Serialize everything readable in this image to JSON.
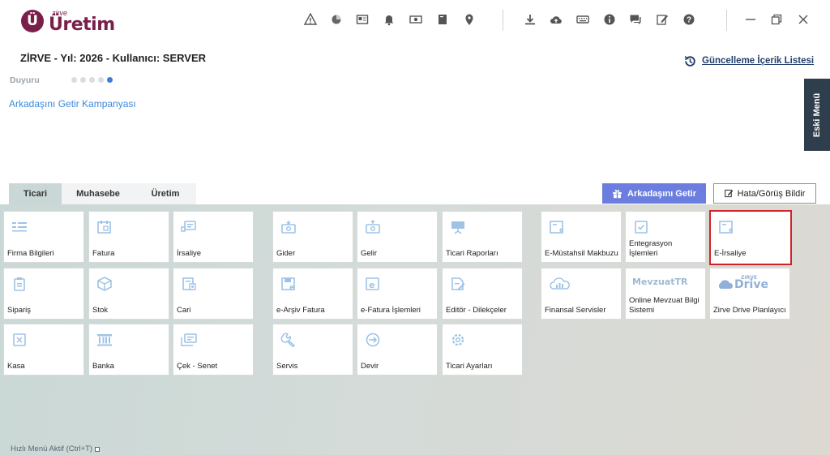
{
  "app": {
    "logo_small": "zirve",
    "logo_big": "Üretim",
    "logo_mark": "Ü",
    "brand_color": "#7a1f4a"
  },
  "toolbar": {
    "icons": [
      "warning-icon",
      "chart-icon",
      "news-icon",
      "bell-icon",
      "money-icon",
      "book-icon",
      "location-icon",
      "download-icon",
      "cloud-upload-icon",
      "keyboard-icon",
      "info-icon",
      "chat-icon",
      "edit-icon",
      "help-icon"
    ],
    "window": [
      "minimize-icon",
      "restore-icon",
      "close-icon"
    ]
  },
  "header": {
    "title": "ZİRVE - Yıl: 2026 - Kullanıcı: SERVER",
    "update_link": "Güncelleme İçerik Listesi",
    "announcement_label": "Duyuru",
    "campaign_link": "Arkadaşını Getir Kampanyası",
    "old_menu": "Eski Menü"
  },
  "tabs": [
    {
      "label": "Ticari",
      "active": true
    },
    {
      "label": "Muhasebe",
      "active": false
    },
    {
      "label": "Üretim",
      "active": false
    }
  ],
  "buttons": {
    "invite_friend": "Arkadaşını Getir",
    "report_bug": "Hata/Görüş Bildir",
    "accent": "#6b7ee0"
  },
  "tiles": [
    {
      "id": "firma",
      "label": "Firma Bilgileri",
      "icon": "list-icon"
    },
    {
      "id": "fatura",
      "label": "Fatura",
      "icon": "invoice-icon"
    },
    {
      "id": "irsaliye",
      "label": "İrsaliye",
      "icon": "truck-icon"
    },
    {
      "id": "gider",
      "label": "Gider",
      "icon": "expense-icon"
    },
    {
      "id": "gelir",
      "label": "Gelir",
      "icon": "income-icon"
    },
    {
      "id": "ticari-raporlar",
      "label": "Ticari Raporları",
      "icon": "presentation-icon"
    },
    {
      "id": "e-mustahsil",
      "label": "E-Müstahsil Makbuzu",
      "icon": "e-document-icon"
    },
    {
      "id": "entegrasyon",
      "label": "Entegrasyon İşlemleri",
      "icon": "check-document-icon"
    },
    {
      "id": "e-irsaliye",
      "label": "E-İrsaliye",
      "icon": "e-document-icon",
      "highlighted": true
    },
    {
      "id": "siparis",
      "label": "Sipariş",
      "icon": "clipboard-icon"
    },
    {
      "id": "stok",
      "label": "Stok",
      "icon": "box-icon"
    },
    {
      "id": "cari",
      "label": "Cari",
      "icon": "account-icon"
    },
    {
      "id": "e-arsiv",
      "label": "e-Arşiv Fatura",
      "icon": "e-archive-icon"
    },
    {
      "id": "e-fatura",
      "label": "e-Fatura İşlemleri",
      "icon": "e-invoice-icon"
    },
    {
      "id": "editor",
      "label": "Editör - Dilekçeler",
      "icon": "editor-icon"
    },
    {
      "id": "finansal",
      "label": "Finansal Servisler",
      "icon": "cloud-finance-icon"
    },
    {
      "id": "mevzuat",
      "label": "Online Mevzuat Bilgi Sistemi",
      "icon": "mevzuat-logo",
      "logo_text": "MevzuatTR"
    },
    {
      "id": "drive",
      "label": "Zirve Drive Planlayıcı",
      "icon": "drive-logo",
      "logo_text": "Drive",
      "logo_small": "ZIRVE"
    },
    {
      "id": "kasa",
      "label": "Kasa",
      "icon": "safe-icon"
    },
    {
      "id": "banka",
      "label": "Banka",
      "icon": "bank-icon"
    },
    {
      "id": "cek-senet",
      "label": "Çek - Senet",
      "icon": "cheque-icon"
    },
    {
      "id": "servis",
      "label": "Servis",
      "icon": "wrench-icon"
    },
    {
      "id": "devir",
      "label": "Devir",
      "icon": "transfer-icon"
    },
    {
      "id": "ticari-ayarlari",
      "label": "Ticari Ayarları",
      "icon": "settings-icon"
    }
  ],
  "footer": {
    "quick_menu": "Hızlı Menü Aktif (Ctrl+T)"
  }
}
